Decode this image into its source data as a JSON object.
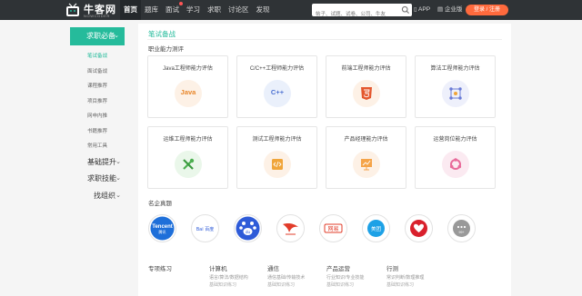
{
  "header": {
    "logo": {
      "cn": "牛客网",
      "en": "NOWCODER"
    },
    "nav": [
      "首页",
      "题库",
      "面试",
      "学习",
      "求职",
      "讨论区",
      "发现"
    ],
    "search_placeholder": "帖子、试题、试卷、公司、牛友",
    "app": "APP",
    "enterprise": "企业版",
    "login": "登录 / 注册",
    "colors": {
      "bar": "#2f3336",
      "login": "#ff6a3d",
      "accent": "#25bb9b"
    }
  },
  "sidebar": {
    "head": "求职必备",
    "subs": [
      "笔试备战",
      "面试备战",
      "课程推荐",
      "项目推荐",
      "网申内推",
      "书籍推荐",
      "常用工具"
    ],
    "cats": [
      "基础提升",
      "求职技能",
      "找组织"
    ]
  },
  "main": {
    "page_title": "笔试备战",
    "ability_title": "职业能力测评",
    "cards": [
      {
        "label": "Java工程师能力评估",
        "icon": "java-icon",
        "icon_text": "Java"
      },
      {
        "label": "C/C++工程师能力评估",
        "icon": "cpp-icon",
        "icon_text": "C++"
      },
      {
        "label": "前端工程师能力评估",
        "icon": "html5-icon"
      },
      {
        "label": "算法工程师能力评估",
        "icon": "network-icon"
      },
      {
        "label": "运维工程师能力评估",
        "icon": "tools-icon"
      },
      {
        "label": "测试工程师能力评估",
        "icon": "code-doc-icon"
      },
      {
        "label": "产品经理能力评估",
        "icon": "chart-board-icon"
      },
      {
        "label": "运营岗位能力评估",
        "icon": "cycle-icon"
      }
    ],
    "company_title": "名企真题",
    "companies": [
      {
        "name": "Tencent",
        "sub": "腾讯",
        "icon": "tencent-logo"
      },
      {
        "name": "百度",
        "sub": "",
        "icon": "baidu-logo"
      },
      {
        "name": "du",
        "sub": "",
        "icon": "baidu-paw-logo"
      },
      {
        "name": "",
        "sub": "",
        "icon": "kuaishou-logo"
      },
      {
        "name": "网易",
        "sub": "",
        "icon": "netease-logo"
      },
      {
        "name": "美团",
        "sub": "",
        "icon": "meituan-logo"
      },
      {
        "name": "",
        "sub": "",
        "icon": "jd-logo"
      },
      {
        "name": "99+",
        "sub": "",
        "icon": "more-icon"
      }
    ],
    "bottom": [
      {
        "title": "专项练习",
        "sub": ""
      },
      {
        "title": "计算机",
        "sub": "语言/算法/数据结构",
        "sub2": "基础知识练习"
      },
      {
        "title": "通信",
        "sub": "通信基础/传输技术",
        "sub2": "基础知识练习"
      },
      {
        "title": "产品运营",
        "sub": "行业知识/专业技能",
        "sub2": "基础知识练习"
      },
      {
        "title": "行测",
        "sub": "常识判断/数理推理",
        "sub2": "基础知识练习"
      }
    ]
  }
}
